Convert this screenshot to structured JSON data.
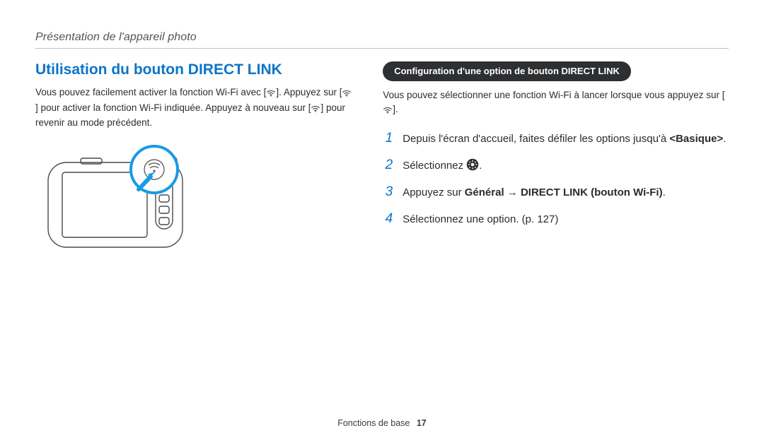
{
  "header": {
    "running_head": "Présentation de l'appareil photo"
  },
  "left": {
    "title": "Utilisation du bouton DIRECT LINK",
    "p1a": "Vous pouvez facilement activer la fonction Wi-Fi avec [",
    "p1b": "]. Appuyez sur [",
    "p1c": "] pour activer la fonction Wi-Fi indiquée. Appuyez à nouveau sur [",
    "p1d": "] pour revenir au mode précédent."
  },
  "right": {
    "pill": "Configuration d'une option de bouton DIRECT LINK",
    "intro_a": "Vous pouvez sélectionner une fonction Wi-Fi à lancer lorsque vous appuyez sur [",
    "intro_b": "].",
    "steps": [
      {
        "n": "1",
        "pre": "Depuis l'écran d'accueil, faites défiler les options jusqu'à ",
        "bold": "<Basique>",
        "post": "."
      },
      {
        "n": "2",
        "text": "Sélectionnez ",
        "icon": "gear",
        "after": "."
      },
      {
        "n": "3",
        "pre": "Appuyez sur ",
        "bold": "Général → DIRECT LINK (bouton Wi-Fi)",
        "post": "."
      },
      {
        "n": "4",
        "text": "Sélectionnez une option. (p. 127)"
      }
    ]
  },
  "footer": {
    "section": "Fonctions de base",
    "page": "17"
  }
}
